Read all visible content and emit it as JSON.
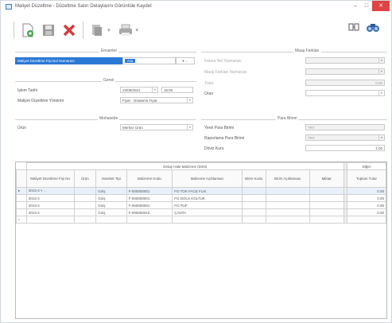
{
  "window": {
    "title": "Maliyet Düzeltme - Düzeltme Satırı Detaylarını Görüntüle Kaydet",
    "min": "–",
    "max": "□",
    "close": "✕"
  },
  "toolbar": {
    "icons": [
      "new-document-icon",
      "save-icon",
      "delete-icon",
      "print-preview-icon",
      "print-icon"
    ],
    "right_icons": [
      "layout-icon",
      "find-icon"
    ]
  },
  "sections": {
    "inventory": "Envanter",
    "general": "Genel",
    "currency": "Para Birimi",
    "vat": "Maaş Farkları",
    "period": "Muhasebe"
  },
  "inventory": {
    "field_label": "Maliyet Düzeltme Fişi No/ Numarası",
    "field_value": "Ara"
  },
  "general": {
    "date_label": "İşlem Tarihi",
    "date_value": "23/09/2021",
    "time_value": "16:00",
    "type_label": "Maliyet Düzeltme Yöntemi",
    "type_value": "Fiyat - Ortalama Fiyat"
  },
  "vat": {
    "rows": [
      {
        "label": "Fatura No/ Numarası",
        "value": ""
      },
      {
        "label": "Maaş Farkları Numarası",
        "value": ""
      },
      {
        "label": "Tutar",
        "value": "0.00"
      },
      {
        "label": "Oran",
        "value": ""
      }
    ]
  },
  "period": {
    "label": "Ürün",
    "value": "Merkez Ürün"
  },
  "currency": {
    "rows": [
      {
        "label": "Yerel Para Birimi",
        "value": "TRY"
      },
      {
        "label": "Raporlama Para Birimi",
        "value": "TRY"
      },
      {
        "label": "Döviz Kuru",
        "value": "1.00"
      }
    ]
  },
  "grid": {
    "group_header": "Detay Hale Malzeme (D4N)",
    "other_header": "Diğer",
    "columns": [
      "Maliyet Düzeltme Fişi No",
      "Ürün",
      "Hareket Tipi",
      "Malzeme Kodu",
      "Malzeme Açıklaması",
      "Birim Kodu",
      "Birim Açıklaması",
      "Miktar",
      "Toplam Tutar"
    ],
    "rows": [
      [
        "2013-4",
        "",
        "Giriş",
        "F-000000001",
        "FO TOK FACE FLIK",
        "",
        "",
        "",
        "0.00"
      ],
      [
        "2013-4",
        "",
        "Giriş",
        "F-000000001",
        "FO DOLS KOLTUK",
        "",
        "",
        "",
        "0.00"
      ],
      [
        "2013-4",
        "",
        "Giriş",
        "F-000000001",
        "FO PUF",
        "",
        "",
        "",
        "0.00"
      ],
      [
        "2013-4",
        "",
        "Giriş",
        "F-000000010",
        "ÇANTA",
        "",
        "",
        "",
        "0.00"
      ]
    ]
  },
  "colors": {
    "accent": "#2a6fbf",
    "delete": "#d23b3b",
    "selection": "#2a78d6"
  }
}
